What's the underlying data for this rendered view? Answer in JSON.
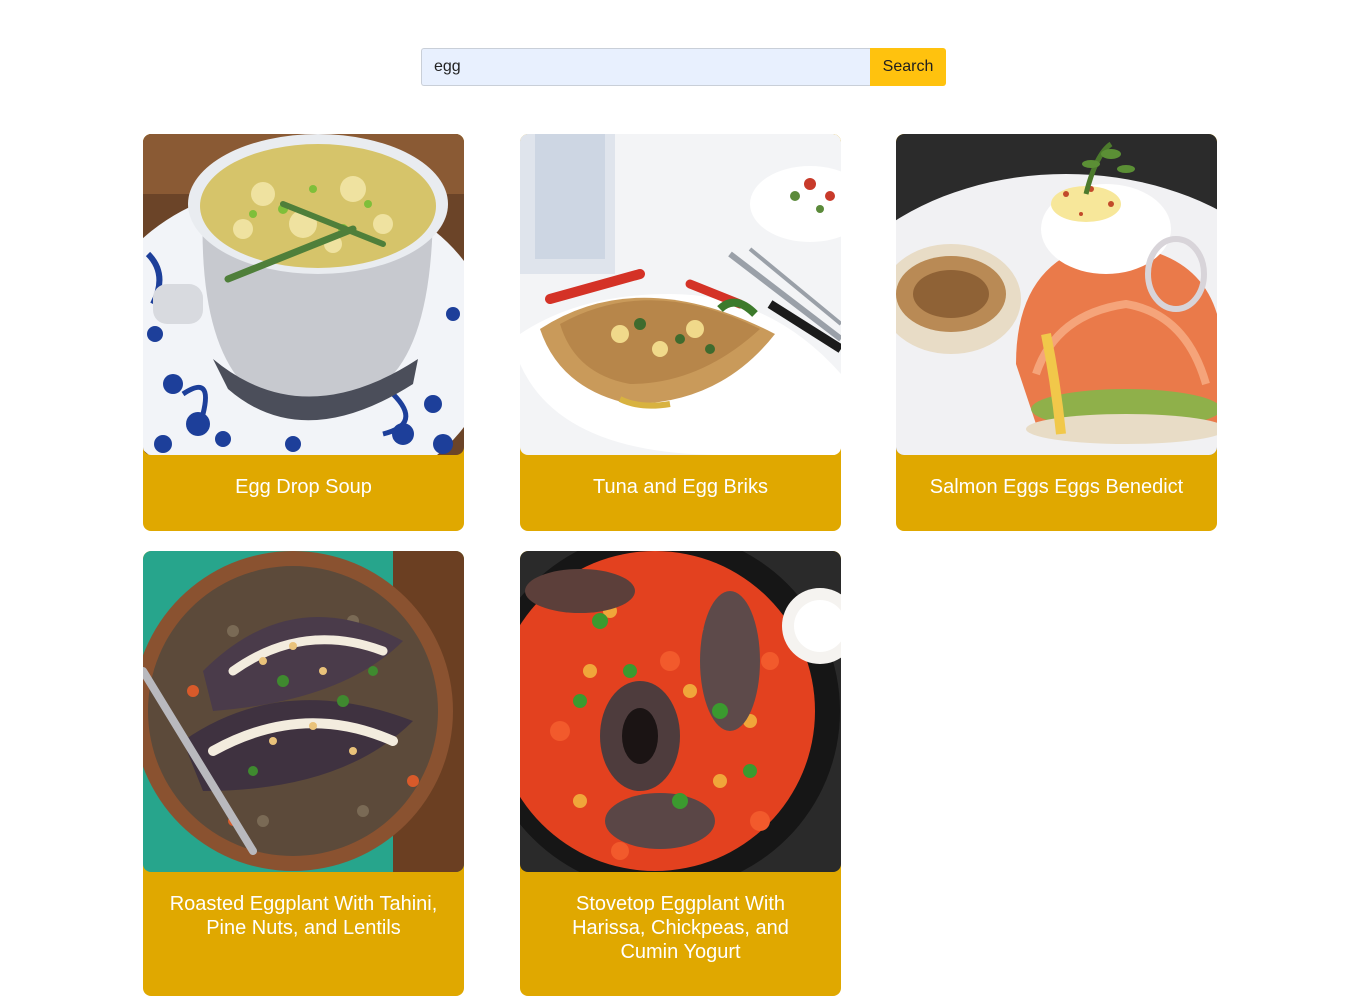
{
  "search": {
    "value": "egg",
    "button_label": "Search"
  },
  "recipes": [
    {
      "title": "Egg Drop Soup",
      "image_icon": "egg-drop-soup-photo"
    },
    {
      "title": "Tuna and Egg Briks",
      "image_icon": "tuna-egg-briks-photo"
    },
    {
      "title": "Salmon Eggs Eggs Benedict",
      "image_icon": "salmon-eggs-benedict-photo"
    },
    {
      "title": "Roasted Eggplant With Tahini, Pine Nuts, and Lentils",
      "image_icon": "roasted-eggplant-photo"
    },
    {
      "title": "Stovetop Eggplant With Harissa, Chickpeas, and Cumin Yogurt",
      "image_icon": "stovetop-eggplant-photo"
    }
  ],
  "colors": {
    "accent": "#ffc20e",
    "card_background": "#e0a800",
    "input_background": "#e8f0fe"
  }
}
